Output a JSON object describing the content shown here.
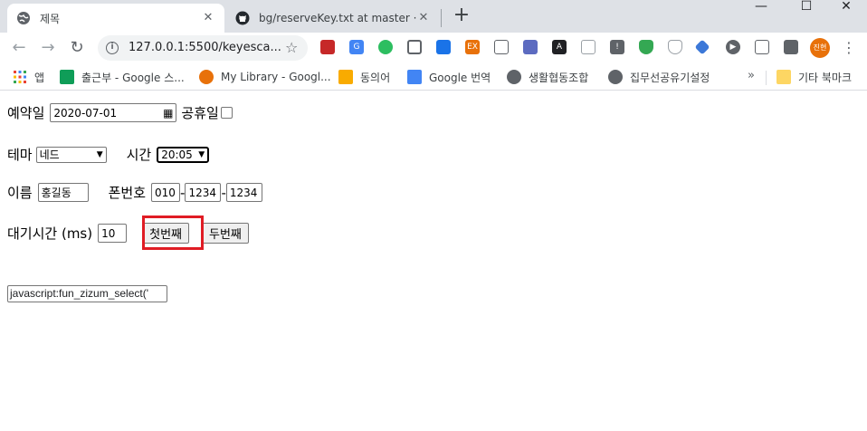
{
  "browser": {
    "tabs": [
      {
        "title": "제목",
        "active": true
      },
      {
        "title": "bg/reserveKey.txt at master · mc"
      }
    ],
    "url": "127.0.0.1:5500/keyesca...",
    "profile_initials": "진현"
  },
  "bookmarks": [
    {
      "label": "앱",
      "icon": "apps-grid-icon"
    },
    {
      "label": "출근부 - Google 스...",
      "icon": "google-sheets-icon"
    },
    {
      "label": "My Library - Googl...",
      "icon": "google-books-icon"
    },
    {
      "label": "동의어",
      "icon": "sun-logo-icon"
    },
    {
      "label": "Google 번역",
      "icon": "google-translate-icon"
    },
    {
      "label": "생활협동조합",
      "icon": "globe-icon"
    },
    {
      "label": "집무선공유기설정",
      "icon": "globe-icon"
    },
    {
      "label": "기타 북마크",
      "icon": "folder-icon"
    }
  ],
  "form": {
    "reserve_date_label": "예약일",
    "reserve_date_value": "2020-07-01",
    "holiday_label": "공휴일",
    "theme_label": "테마",
    "theme_value": "네드",
    "time_label": "시간",
    "time_value": "20:05",
    "name_label": "이름",
    "name_value": "홍길동",
    "phone_label": "폰번호",
    "phone_1": "010",
    "phone_2": "1234",
    "phone_3": "1234",
    "phone_dash": "-",
    "wait_label": "대기시간 (ms)",
    "wait_value": "10",
    "first_button": "첫번째",
    "second_button": "두번째",
    "js_value": "javascript:fun_zizum_select('"
  }
}
